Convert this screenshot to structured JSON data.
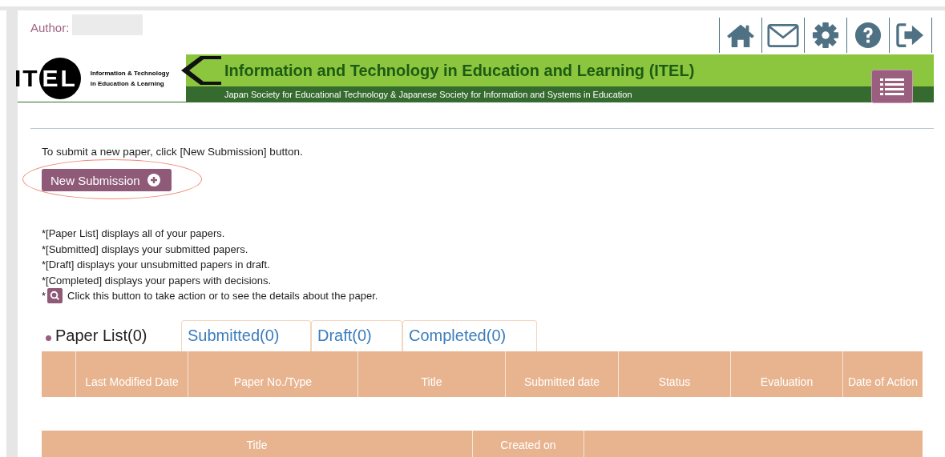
{
  "header": {
    "author_label": "Author:",
    "logo": {
      "letters_left": "IT",
      "letters_right": "EL",
      "tagline": [
        "Information & Technology",
        "in Education & Learning"
      ]
    },
    "title": "Information and Technology in Education and Learning (ITEL)",
    "subtitle": "Japan Society for Educational Technology & Japanese Society for Information and Systems in Education"
  },
  "intro": "To submit a new paper, click [New Submission] button.",
  "new_submission": {
    "label": "New Submission",
    "highlighted": true
  },
  "notes": [
    "*[Paper List] displays all of your papers.",
    "*[Submitted] displays your submitted papers.",
    "*[Draft] displays your unsubmitted papers in draft.",
    "*[Completed] displays your papers with decisions."
  ],
  "search_note": {
    "prefix": "*",
    "text": "Click this button to take action or to see the details about the paper."
  },
  "tabs": [
    {
      "label": "Paper List(0)",
      "selected": true
    },
    {
      "label": "Submitted(0)",
      "selected": false
    },
    {
      "label": "Draft(0)",
      "selected": false
    },
    {
      "label": "Completed(0)",
      "selected": false
    }
  ],
  "papers_table": {
    "columns": [
      "",
      "Last Modified Date",
      "Paper No./Type",
      "Title",
      "Submitted date",
      "Status",
      "Evaluation",
      "Date of Action"
    ]
  },
  "drafts_table": {
    "columns": [
      "Title",
      "Created on",
      ""
    ]
  }
}
